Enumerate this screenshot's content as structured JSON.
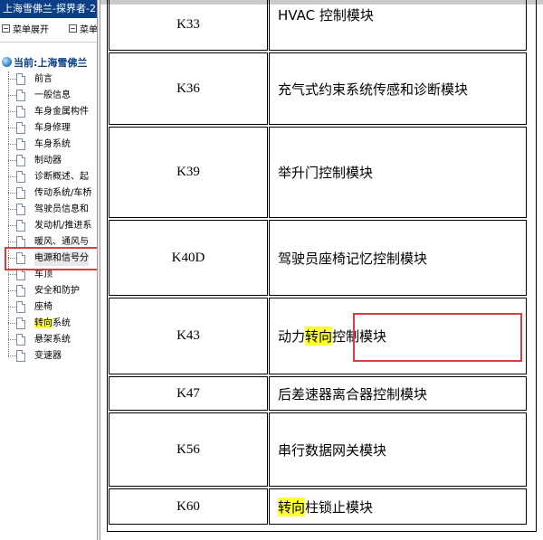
{
  "left_pane": {
    "title": "上海雪佛兰-探界者-2",
    "toolbar": {
      "expand_label": "菜单展开",
      "collapse_label": "菜单"
    },
    "tree_root": "当前:上海雪佛兰",
    "items": [
      {
        "label": "前言"
      },
      {
        "label": "一般信息"
      },
      {
        "label": "车身金属构件"
      },
      {
        "label": "车身修理"
      },
      {
        "label": "车身系统"
      },
      {
        "label": "制动器"
      },
      {
        "label": "诊断概述、起"
      },
      {
        "label": "传动系统/车桥"
      },
      {
        "label": "驾驶员信息和"
      },
      {
        "label": "发动机/推进系"
      },
      {
        "label": "暖风、通风与"
      },
      {
        "label": "电源和信号分"
      },
      {
        "label": "车顶"
      },
      {
        "label": "安全和防护"
      },
      {
        "label": "座椅"
      },
      {
        "label_hl": "转向",
        "label_rest": "系统"
      },
      {
        "label": "悬架系统"
      },
      {
        "label": "变速器"
      }
    ],
    "highlight_color": "#ffff33",
    "annotation_color": "#e03a3a"
  },
  "table": {
    "rows": [
      {
        "code": "K33",
        "name": "HVAC 控制模块"
      },
      {
        "code": "K36",
        "name": "充气式约束系统传感和诊断模块"
      },
      {
        "code": "K39",
        "name": "举升门控制模块"
      },
      {
        "code": "K40D",
        "name": "驾驶员座椅记忆控制模块"
      },
      {
        "code": "K43",
        "name_pre": "动力",
        "name_hl": "转向",
        "name_post": "控制模块"
      },
      {
        "code": "K47",
        "name": "后差速器离合器控制模块"
      },
      {
        "code": "K56",
        "name": "串行数据网关模块"
      },
      {
        "code": "K60",
        "name_hl": "转向",
        "name_post": "柱锁止模块"
      }
    ]
  }
}
